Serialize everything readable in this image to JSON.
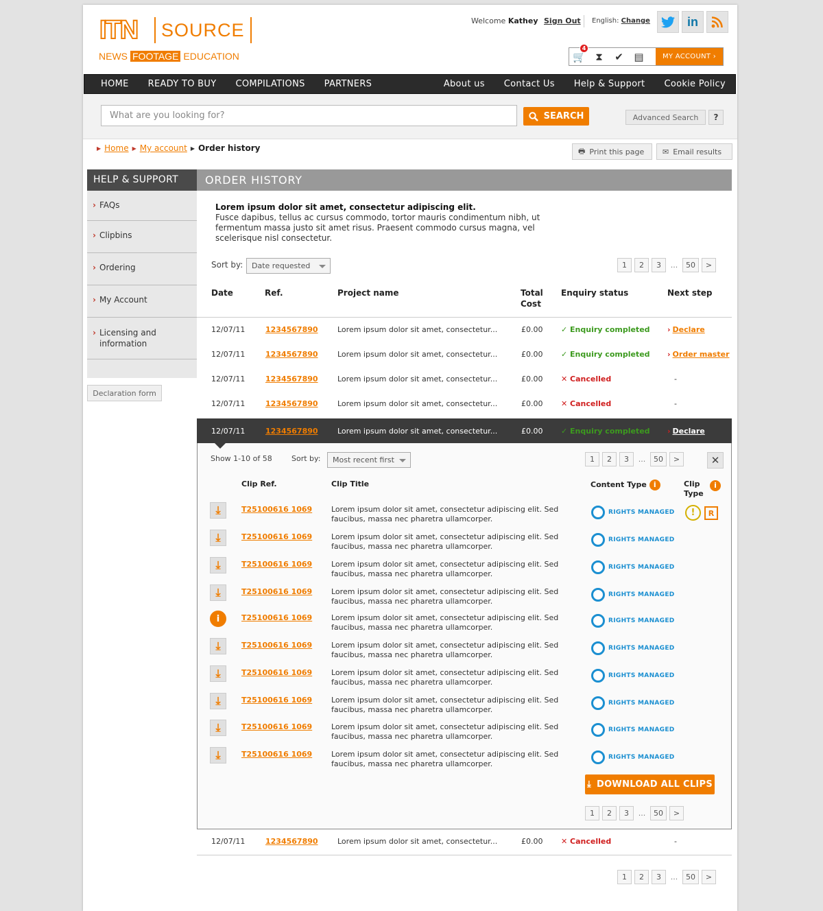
{
  "header": {
    "logo": {
      "itn": "ITN",
      "source": "SOURCE",
      "sub": [
        "NEWS",
        "FOOTAGE",
        "EDUCATION"
      ]
    },
    "welcome_prefix": "Welcome",
    "user_name": "Kathey",
    "sign_out": "Sign Out",
    "language_label": "English:",
    "language_change": "Change",
    "social": [
      {
        "icon": "twitter-icon",
        "glyph": "t"
      },
      {
        "icon": "linkedin-icon",
        "glyph": "in"
      },
      {
        "icon": "rss-icon",
        "glyph": "◉"
      }
    ],
    "cart_count": "4",
    "my_account": "MY ACCOUNT"
  },
  "nav": {
    "left": [
      "HOME",
      "READY TO BUY",
      "COMPILATIONS",
      "PARTNERS"
    ],
    "right": [
      "About us",
      "Contact Us",
      "Help & Support",
      "Cookie Policy"
    ]
  },
  "search": {
    "placeholder": "What are you looking for?",
    "button": "SEARCH",
    "advanced": "Advanced Search",
    "help": "?"
  },
  "breadcrumb": {
    "home": "Home",
    "account": "My account",
    "current": "Order history"
  },
  "tools": {
    "print": "Print this page",
    "email": "Email results"
  },
  "sidebar": {
    "title": "HELP & SUPPORT",
    "items": [
      "FAQs",
      "Clipbins",
      "Ordering",
      "My Account",
      "Licensing and information"
    ],
    "declaration": "Declaration form"
  },
  "main": {
    "title": "ORDER HISTORY",
    "intro_bold": "Lorem ipsum dolor sit amet, consectetur adipiscing elit.",
    "intro_text": "Fusce dapibus, tellus ac cursus commodo, tortor mauris condimentum nibh, ut fermentum massa justo sit amet risus. Praesent commodo cursus magna, vel scelerisque nisl consectetur.",
    "sort_label": "Sort by:",
    "sort_value": "Date requested",
    "pages": [
      "1",
      "2",
      "3",
      "...",
      "50",
      ">"
    ],
    "columns": {
      "date": "Date",
      "ref": "Ref.",
      "project": "Project name",
      "cost": "Total Cost",
      "status": "Enquiry status",
      "next": "Next step"
    },
    "orders": [
      {
        "date": "12/07/11",
        "ref": "1234567890",
        "project": "Lorem ipsum dolor sit amet, consectetur...",
        "cost": "£0.00",
        "status": "Enquiry completed",
        "state": "ok",
        "next": "Declare"
      },
      {
        "date": "12/07/11",
        "ref": "1234567890",
        "project": "Lorem ipsum dolor sit amet, consectetur...",
        "cost": "£0.00",
        "status": "Enquiry completed",
        "state": "ok",
        "next": "Order master"
      },
      {
        "date": "12/07/11",
        "ref": "1234567890",
        "project": "Lorem ipsum dolor sit amet, consectetur...",
        "cost": "£0.00",
        "status": "Cancelled",
        "state": "cx",
        "next": "-"
      },
      {
        "date": "12/07/11",
        "ref": "1234567890",
        "project": "Lorem ipsum dolor sit amet, consectetur...",
        "cost": "£0.00",
        "status": "Cancelled",
        "state": "cx",
        "next": "-"
      },
      {
        "date": "12/07/11",
        "ref": "1234567890",
        "project": "Lorem ipsum dolor sit amet, consectetur...",
        "cost": "£0.00",
        "status": "Enquiry completed",
        "state": "ok",
        "next": "Declare"
      },
      {
        "date": "12/07/11",
        "ref": "1234567890",
        "project": "Lorem ipsum dolor sit amet, consectetur...",
        "cost": "£0.00",
        "status": "Cancelled",
        "state": "cx",
        "next": "-"
      }
    ]
  },
  "detail": {
    "show": "Show 1-10 of 58",
    "sort_label": "Sort by:",
    "sort_value": "Most recent first",
    "pages": [
      "1",
      "2",
      "3",
      "...",
      "50",
      ">"
    ],
    "close": "✕",
    "columns": {
      "ref": "Clip Ref.",
      "title": "Clip Title",
      "content_type": "Content Type",
      "clip_type": "Clip Type"
    },
    "clips": [
      {
        "ref": "T25100616 1069",
        "title": "Lorem ipsum dolor sit amet, consectetur adipiscing elit. Sed faucibus, massa nec pharetra ullamcorper.",
        "type": "RIGHTS MANAGED",
        "action": "download-icon",
        "clip_type": [
          "!",
          "R"
        ]
      },
      {
        "ref": "T25100616 1069",
        "title": "Lorem ipsum dolor sit amet, consectetur adipiscing elit. Sed faucibus, massa nec pharetra ullamcorper.",
        "type": "RIGHTS MANAGED",
        "action": "download-icon"
      },
      {
        "ref": "T25100616 1069",
        "title": "Lorem ipsum dolor sit amet, consectetur adipiscing elit. Sed faucibus, massa nec pharetra ullamcorper.",
        "type": "RIGHTS MANAGED",
        "action": "download-icon"
      },
      {
        "ref": "T25100616 1069",
        "title": "Lorem ipsum dolor sit amet, consectetur adipiscing elit. Sed faucibus, massa nec pharetra ullamcorper.",
        "type": "RIGHTS MANAGED",
        "action": "download-icon"
      },
      {
        "ref": "T25100616 1069",
        "title": "Lorem ipsum dolor sit amet, consectetur adipiscing elit. Sed faucibus, massa nec pharetra ullamcorper.",
        "type": "RIGHTS MANAGED",
        "action": "info-icon"
      },
      {
        "ref": "T25100616 1069",
        "title": "Lorem ipsum dolor sit amet, consectetur adipiscing elit. Sed faucibus, massa nec pharetra ullamcorper.",
        "type": "RIGHTS MANAGED",
        "action": "download-icon"
      },
      {
        "ref": "T25100616 1069",
        "title": "Lorem ipsum dolor sit amet, consectetur adipiscing elit. Sed faucibus, massa nec pharetra ullamcorper.",
        "type": "RIGHTS MANAGED",
        "action": "download-icon"
      },
      {
        "ref": "T25100616 1069",
        "title": "Lorem ipsum dolor sit amet, consectetur adipiscing elit. Sed faucibus, massa nec pharetra ullamcorper.",
        "type": "RIGHTS MANAGED",
        "action": "download-icon"
      },
      {
        "ref": "T25100616 1069",
        "title": "Lorem ipsum dolor sit amet, consectetur adipiscing elit. Sed faucibus, massa nec pharetra ullamcorper.",
        "type": "RIGHTS MANAGED",
        "action": "download-icon"
      },
      {
        "ref": "T25100616 1069",
        "title": "Lorem ipsum dolor sit amet, consectetur adipiscing elit. Sed faucibus, massa nec pharetra ullamcorper.",
        "type": "RIGHTS MANAGED",
        "action": "download-icon"
      }
    ],
    "download_all": "DOWNLOAD ALL CLIPS"
  },
  "bottom_pages": [
    "1",
    "2",
    "3",
    "...",
    "50",
    ">"
  ],
  "colors": {
    "accent": "#f07d00",
    "nav": "#2b2b2b",
    "ok": "#3c9a1e",
    "cancel": "#d01f1f",
    "rights": "#1b8fd1"
  }
}
